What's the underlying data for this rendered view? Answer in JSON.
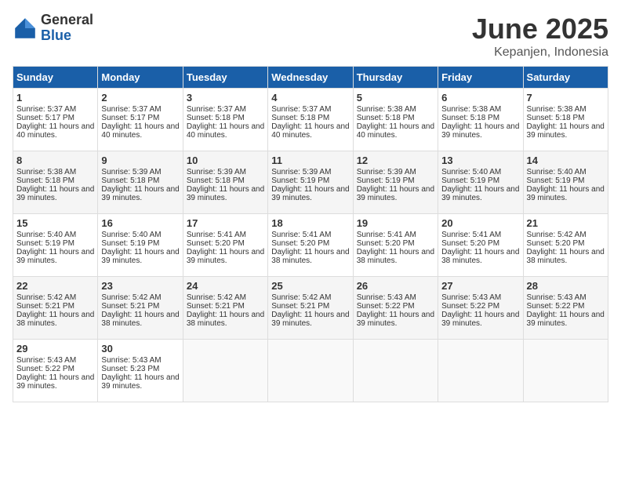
{
  "header": {
    "logo_general": "General",
    "logo_blue": "Blue",
    "month_title": "June 2025",
    "location": "Kepanjen, Indonesia"
  },
  "days_of_week": [
    "Sunday",
    "Monday",
    "Tuesday",
    "Wednesday",
    "Thursday",
    "Friday",
    "Saturday"
  ],
  "weeks": [
    [
      {
        "day": "1",
        "sunrise": "5:37 AM",
        "sunset": "5:17 PM",
        "daylight": "11 hours and 40 minutes."
      },
      {
        "day": "2",
        "sunrise": "5:37 AM",
        "sunset": "5:17 PM",
        "daylight": "11 hours and 40 minutes."
      },
      {
        "day": "3",
        "sunrise": "5:37 AM",
        "sunset": "5:18 PM",
        "daylight": "11 hours and 40 minutes."
      },
      {
        "day": "4",
        "sunrise": "5:37 AM",
        "sunset": "5:18 PM",
        "daylight": "11 hours and 40 minutes."
      },
      {
        "day": "5",
        "sunrise": "5:38 AM",
        "sunset": "5:18 PM",
        "daylight": "11 hours and 40 minutes."
      },
      {
        "day": "6",
        "sunrise": "5:38 AM",
        "sunset": "5:18 PM",
        "daylight": "11 hours and 39 minutes."
      },
      {
        "day": "7",
        "sunrise": "5:38 AM",
        "sunset": "5:18 PM",
        "daylight": "11 hours and 39 minutes."
      }
    ],
    [
      {
        "day": "8",
        "sunrise": "5:38 AM",
        "sunset": "5:18 PM",
        "daylight": "11 hours and 39 minutes."
      },
      {
        "day": "9",
        "sunrise": "5:39 AM",
        "sunset": "5:18 PM",
        "daylight": "11 hours and 39 minutes."
      },
      {
        "day": "10",
        "sunrise": "5:39 AM",
        "sunset": "5:18 PM",
        "daylight": "11 hours and 39 minutes."
      },
      {
        "day": "11",
        "sunrise": "5:39 AM",
        "sunset": "5:19 PM",
        "daylight": "11 hours and 39 minutes."
      },
      {
        "day": "12",
        "sunrise": "5:39 AM",
        "sunset": "5:19 PM",
        "daylight": "11 hours and 39 minutes."
      },
      {
        "day": "13",
        "sunrise": "5:40 AM",
        "sunset": "5:19 PM",
        "daylight": "11 hours and 39 minutes."
      },
      {
        "day": "14",
        "sunrise": "5:40 AM",
        "sunset": "5:19 PM",
        "daylight": "11 hours and 39 minutes."
      }
    ],
    [
      {
        "day": "15",
        "sunrise": "5:40 AM",
        "sunset": "5:19 PM",
        "daylight": "11 hours and 39 minutes."
      },
      {
        "day": "16",
        "sunrise": "5:40 AM",
        "sunset": "5:19 PM",
        "daylight": "11 hours and 39 minutes."
      },
      {
        "day": "17",
        "sunrise": "5:41 AM",
        "sunset": "5:20 PM",
        "daylight": "11 hours and 39 minutes."
      },
      {
        "day": "18",
        "sunrise": "5:41 AM",
        "sunset": "5:20 PM",
        "daylight": "11 hours and 38 minutes."
      },
      {
        "day": "19",
        "sunrise": "5:41 AM",
        "sunset": "5:20 PM",
        "daylight": "11 hours and 38 minutes."
      },
      {
        "day": "20",
        "sunrise": "5:41 AM",
        "sunset": "5:20 PM",
        "daylight": "11 hours and 38 minutes."
      },
      {
        "day": "21",
        "sunrise": "5:42 AM",
        "sunset": "5:20 PM",
        "daylight": "11 hours and 38 minutes."
      }
    ],
    [
      {
        "day": "22",
        "sunrise": "5:42 AM",
        "sunset": "5:21 PM",
        "daylight": "11 hours and 38 minutes."
      },
      {
        "day": "23",
        "sunrise": "5:42 AM",
        "sunset": "5:21 PM",
        "daylight": "11 hours and 38 minutes."
      },
      {
        "day": "24",
        "sunrise": "5:42 AM",
        "sunset": "5:21 PM",
        "daylight": "11 hours and 38 minutes."
      },
      {
        "day": "25",
        "sunrise": "5:42 AM",
        "sunset": "5:21 PM",
        "daylight": "11 hours and 39 minutes."
      },
      {
        "day": "26",
        "sunrise": "5:43 AM",
        "sunset": "5:22 PM",
        "daylight": "11 hours and 39 minutes."
      },
      {
        "day": "27",
        "sunrise": "5:43 AM",
        "sunset": "5:22 PM",
        "daylight": "11 hours and 39 minutes."
      },
      {
        "day": "28",
        "sunrise": "5:43 AM",
        "sunset": "5:22 PM",
        "daylight": "11 hours and 39 minutes."
      }
    ],
    [
      {
        "day": "29",
        "sunrise": "5:43 AM",
        "sunset": "5:22 PM",
        "daylight": "11 hours and 39 minutes."
      },
      {
        "day": "30",
        "sunrise": "5:43 AM",
        "sunset": "5:23 PM",
        "daylight": "11 hours and 39 minutes."
      },
      null,
      null,
      null,
      null,
      null
    ]
  ]
}
